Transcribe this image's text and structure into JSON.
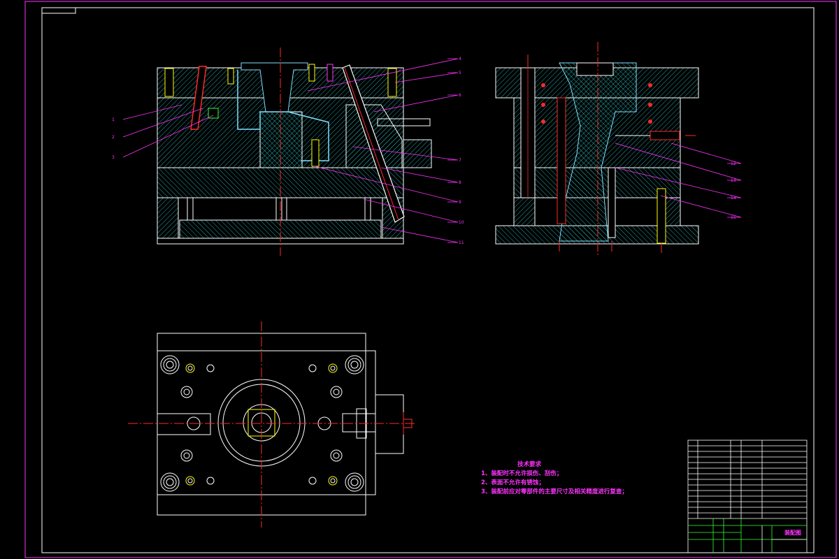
{
  "drawing": {
    "colors": {
      "background": "#000000",
      "border": "#ff33ff",
      "outline": "#ffffff",
      "hatch": "#2aa5a5",
      "centerline": "#ff2a2a",
      "leader": "#ff33ff",
      "core": "#7fdfff",
      "bolt": "#ffff00"
    },
    "front_view_leaders": [
      "1",
      "2",
      "3",
      "4",
      "5",
      "6",
      "7",
      "8",
      "9",
      "10",
      "11"
    ],
    "side_view_leaders": [
      "12",
      "13",
      "14",
      "15"
    ],
    "technical_notes": {
      "title": "技术要求",
      "lines": [
        "1、装配时不允许损伤、刮伤；",
        "2、表面不允许有锈蚀；",
        "3、装配前应对零部件的主要尺寸及相关精度进行复查；"
      ]
    },
    "title_block": {
      "name": "装配图"
    }
  }
}
